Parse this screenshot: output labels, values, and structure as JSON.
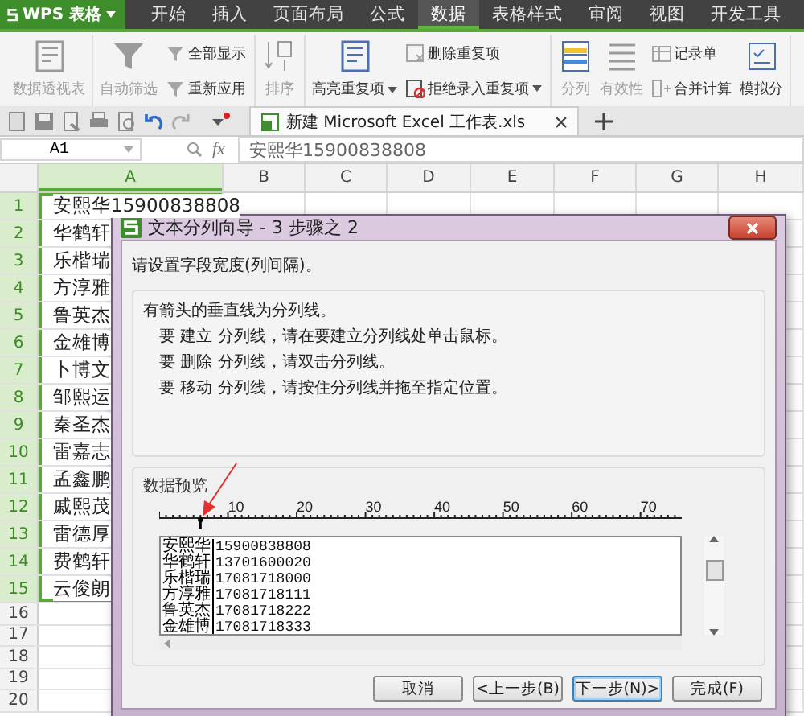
{
  "app": {
    "name": "WPS 表格"
  },
  "menu_tabs": [
    {
      "label": "开始",
      "selected": false
    },
    {
      "label": "插入",
      "selected": false
    },
    {
      "label": "页面布局",
      "selected": false
    },
    {
      "label": "公式",
      "selected": false
    },
    {
      "label": "数据",
      "selected": true
    },
    {
      "label": "表格样式",
      "selected": false
    },
    {
      "label": "审阅",
      "selected": false
    },
    {
      "label": "视图",
      "selected": false
    },
    {
      "label": "开发工具",
      "selected": false
    }
  ],
  "ribbon": {
    "groups": [
      {
        "items": [
          {
            "kind": "large",
            "label": "数据透视表",
            "disabled": true
          }
        ]
      },
      {
        "items": [
          {
            "kind": "large",
            "label": "自动筛选",
            "disabled": true
          },
          {
            "kind": "small",
            "label": "全部显示",
            "disabled": true
          },
          {
            "kind": "small",
            "label": "重新应用",
            "disabled": true
          }
        ]
      },
      {
        "items": [
          {
            "kind": "sort",
            "label": "排序",
            "disabled": true
          }
        ]
      },
      {
        "items": [
          {
            "kind": "large",
            "label": "高亮重复项",
            "disabled": false,
            "dropdown": true
          },
          {
            "kind": "small",
            "label": "删除重复项",
            "disabled": true
          },
          {
            "kind": "small",
            "label": "拒绝录入重复项",
            "disabled": false,
            "dropdown": true
          }
        ]
      },
      {
        "items": [
          {
            "kind": "large",
            "label": "分列",
            "disabled": true
          },
          {
            "kind": "large",
            "label": "有效性",
            "disabled": true
          },
          {
            "kind": "small",
            "label": "记录单",
            "disabled": true
          },
          {
            "kind": "small",
            "label": "合并计算",
            "disabled": true
          },
          {
            "kind": "large",
            "label": "模拟分",
            "disabled": false
          }
        ]
      }
    ]
  },
  "document_tab": {
    "title": "新建 Microsoft Excel 工作表.xls"
  },
  "formula_bar": {
    "cell_ref": "A1",
    "fx_label": "fx",
    "content": "安熙华15900838808"
  },
  "sheet": {
    "columns": [
      {
        "label": "A",
        "selected": true
      },
      {
        "label": "B",
        "selected": false
      },
      {
        "label": "C",
        "selected": false
      },
      {
        "label": "D",
        "selected": false
      },
      {
        "label": "E",
        "selected": false
      },
      {
        "label": "F",
        "selected": false
      },
      {
        "label": "G",
        "selected": false
      },
      {
        "label": "H",
        "selected": false
      }
    ],
    "rows": [
      {
        "number": "1",
        "selected": true,
        "cell_a": "安熙华15900838808"
      },
      {
        "number": "2",
        "selected": true,
        "cell_a": "华鹤轩"
      },
      {
        "number": "3",
        "selected": true,
        "cell_a": "乐楷瑞"
      },
      {
        "number": "4",
        "selected": true,
        "cell_a": "方淳雅"
      },
      {
        "number": "5",
        "selected": true,
        "cell_a": "鲁英杰"
      },
      {
        "number": "6",
        "selected": true,
        "cell_a": "金雄博"
      },
      {
        "number": "7",
        "selected": true,
        "cell_a": "卜博文"
      },
      {
        "number": "8",
        "selected": true,
        "cell_a": "邹熙运"
      },
      {
        "number": "9",
        "selected": true,
        "cell_a": "秦圣杰"
      },
      {
        "number": "10",
        "selected": true,
        "cell_a": "雷嘉志"
      },
      {
        "number": "11",
        "selected": true,
        "cell_a": "孟鑫鹏"
      },
      {
        "number": "12",
        "selected": true,
        "cell_a": "戚熙茂"
      },
      {
        "number": "13",
        "selected": true,
        "cell_a": "雷德厚"
      },
      {
        "number": "14",
        "selected": true,
        "cell_a": "费鹤轩"
      },
      {
        "number": "15",
        "selected": true,
        "cell_a": "云俊朗"
      },
      {
        "number": "16",
        "selected": false
      },
      {
        "number": "17",
        "selected": false
      },
      {
        "number": "18",
        "selected": false
      },
      {
        "number": "19",
        "selected": false
      },
      {
        "number": "20",
        "selected": false
      }
    ]
  },
  "dialog": {
    "title": "文本分列向导 - 3 步骤之 2",
    "prompt": "请设置字段宽度(列间隔)。",
    "help_heading": "有箭头的垂直线为分列线。",
    "help_lines": [
      "要 建立 分列线，请在要建立分列线处单击鼠标。",
      "要 删除 分列线，请双击分列线。",
      "要 移动 分列线，请按住分列线并拖至指定位置。"
    ],
    "preview": {
      "label": "数据预览",
      "ruler_labels": [
        "10",
        "20",
        "30",
        "40",
        "50",
        "60",
        "70"
      ],
      "rows": [
        {
          "name": "安熙华",
          "value": "15900838808"
        },
        {
          "name": "华鹤轩",
          "value": "13701600020"
        },
        {
          "name": "乐楷瑞",
          "value": "17081718000"
        },
        {
          "name": "方淳雅",
          "value": "17081718111"
        },
        {
          "name": "鲁英杰",
          "value": "17081718222"
        },
        {
          "name": "金雄博",
          "value": "17081718333"
        }
      ]
    },
    "buttons": [
      {
        "label": "取消",
        "default": false
      },
      {
        "label": "<上一步(B)",
        "default": false
      },
      {
        "label": "下一步(N)>",
        "default": true
      },
      {
        "label": "完成(F)",
        "default": false
      }
    ]
  }
}
